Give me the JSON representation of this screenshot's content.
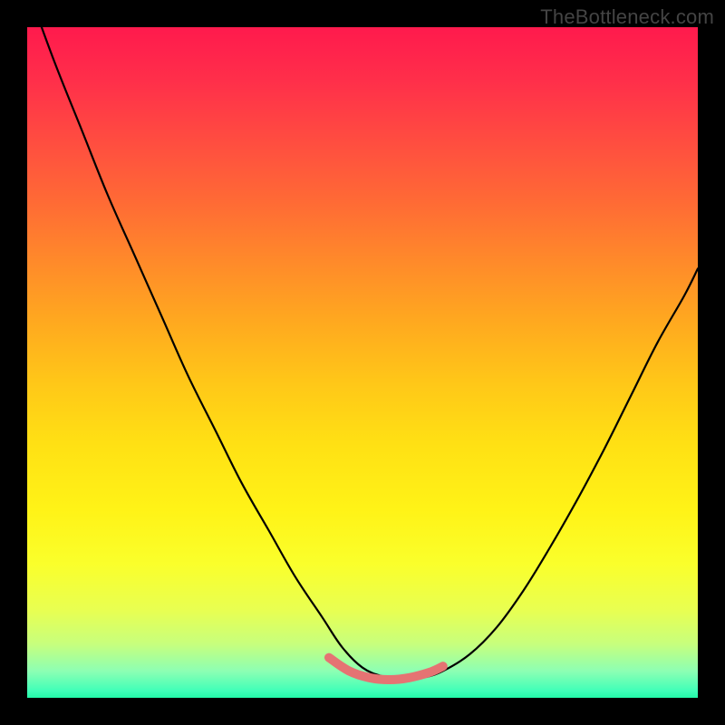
{
  "watermark": "TheBottleneck.com",
  "colors": {
    "frame": "#000000",
    "curve_stroke": "#000000",
    "highlight_stroke": "#e57373",
    "gradient_top": "#ff1a4d",
    "gradient_bottom": "#23f9a8"
  },
  "chart_data": {
    "type": "line",
    "title": "",
    "xlabel": "",
    "ylabel": "",
    "xlim": [
      0,
      100
    ],
    "ylim": [
      0,
      100
    ],
    "note": "Values are read in percent of plot-area width/height. y is plotted downward (0=top, 100=bottom). The curve is the visible V-shaped black line; 'highlight' is the pink segment near the trough.",
    "series": [
      {
        "name": "curve",
        "x": [
          0,
          4,
          8,
          12,
          16,
          20,
          24,
          28,
          32,
          36,
          40,
          44,
          47,
          50,
          53,
          56,
          59,
          62,
          66,
          70,
          74,
          78,
          82,
          86,
          90,
          94,
          98,
          100
        ],
        "y": [
          -6,
          5,
          15,
          25,
          34,
          43,
          52,
          60,
          68,
          75,
          82,
          88,
          92.5,
          95.5,
          96.8,
          97.2,
          97,
          96,
          93.5,
          89.5,
          84,
          77.5,
          70.5,
          63,
          55,
          47,
          40,
          36
        ]
      },
      {
        "name": "highlight",
        "x": [
          45,
          48,
          51,
          54,
          57,
          60,
          62
        ],
        "y": [
          94,
          96,
          97,
          97.3,
          97,
          96.2,
          95.3
        ]
      }
    ]
  }
}
